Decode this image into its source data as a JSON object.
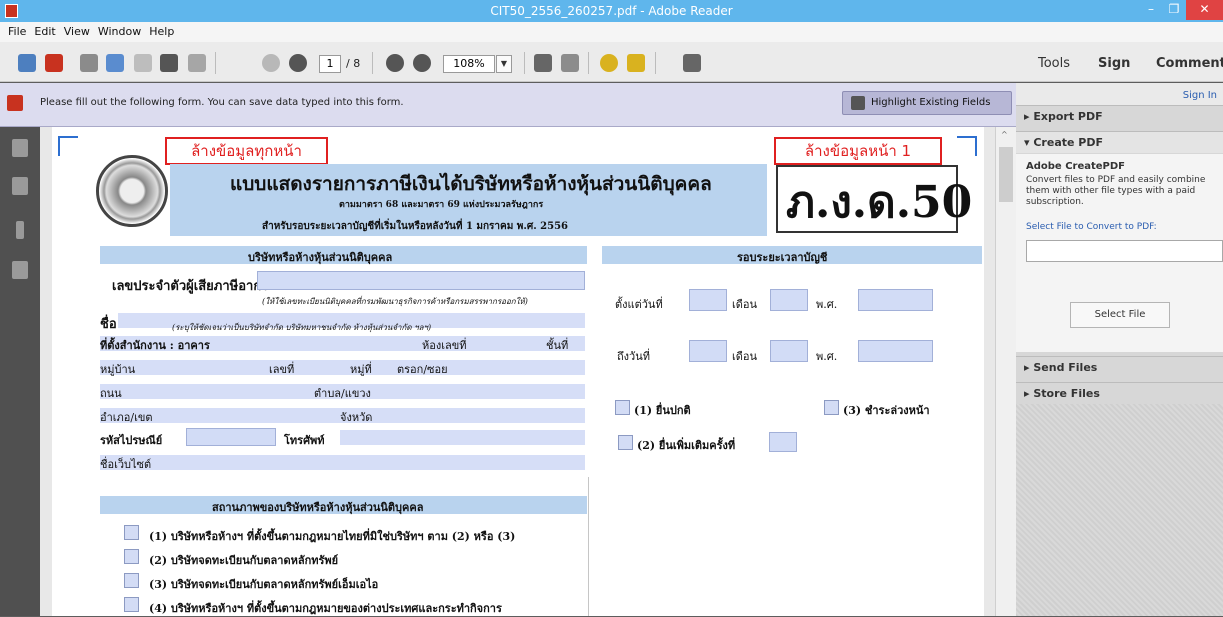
{
  "window": {
    "title": "CIT50_2556_260257.pdf - Adobe Reader",
    "min": "–",
    "restore": "❐",
    "close": "✕"
  },
  "menu": [
    "File",
    "Edit",
    "View",
    "Window",
    "Help"
  ],
  "toolbar": {
    "page_current": "1",
    "page_total": "/ 8",
    "zoom": "108%",
    "tabs": [
      "Tools",
      "Sign",
      "Comment"
    ]
  },
  "notice": {
    "text": "Please fill out the following form. You can save data typed into this form.",
    "button": "Highlight Existing Fields"
  },
  "panel": {
    "sign_in": "Sign In",
    "export": "Export PDF",
    "create": "Create PDF",
    "createpdf_title": "Adobe CreatePDF",
    "createpdf_desc": "Convert files to PDF and easily combine them with other file types with a paid subscription.",
    "select_label": "Select File to Convert to PDF:",
    "select_btn": "Select File",
    "send": "Send Files",
    "store": "Store Files"
  },
  "form": {
    "clear_all": "ล้างข้อมูลทุกหน้า",
    "clear_page": "ล้างข้อมูลหน้า 1",
    "title": "แบบแสดงรายการภาษีเงินได้บริษัทหรือห้างหุ้นส่วนนิติบุคคล",
    "law": "ตามมาตรา 68 และมาตรา 69 แห่งประมวลรัษฎากร",
    "period_line": "สำหรับรอบระยะเวลาบัญชีที่เริ่มในหรือหลังวันที่ 1 มกราคม พ.ศ. 2556",
    "form_code": "ภ.ง.ด.50",
    "sec_company": "บริษัทหรือห้างหุ้นส่วนนิติบุคคล",
    "sec_period": "รอบระยะเวลาบัญชี",
    "taxid": "เลขประจำตัวผู้เสียภาษีอากร",
    "taxid_note": "(ให้ใช้เลขทะเบียนนิติบุคคลที่กรมพัฒนาธุรกิจการค้าหรือกรมสรรพากรออกให้)",
    "name": "ชื่อ",
    "name_note": "(ระบุให้ชัดเจนว่าเป็นบริษัทจำกัด บริษัทมหาชนจำกัด ห้างหุ้นส่วนจำกัด ฯลฯ)",
    "office": "ที่ตั้งสำนักงาน : อาคาร",
    "room": "ห้องเลขที่",
    "floor": "ชั้นที่",
    "village": "หมู่บ้าน",
    "addr_no": "เลขที่",
    "moo": "หมู่ที่",
    "soi": "ตรอก/ซอย",
    "road": "ถนน",
    "subdistrict": "ตำบล/แขวง",
    "district": "อำเภอ/เขต",
    "province": "จังหวัด",
    "postcode": "รหัสไปรษณีย์",
    "phone": "โทรศัพท์",
    "website": "ชื่อเว็บไซต์",
    "from_day": "ตั้งแต่วันที่",
    "to_day": "ถึงวันที่",
    "month": "เดือน",
    "year": "พ.ศ.",
    "opt1": "(1) ยื่นปกติ",
    "opt2": "(2) ยื่นเพิ่มเติมครั้งที่",
    "opt3": "(3) ชำระล่วงหน้า",
    "sec_status": "สถานภาพของบริษัทหรือห้างหุ้นส่วนนิติบุคคล",
    "status": [
      "(1)  บริษัทหรือห้างฯ ที่ตั้งขึ้นตามกฎหมายไทยที่มิใช่บริษัทฯ ตาม (2) หรือ (3)",
      "(2)  บริษัทจดทะเบียนกับตลาดหลักทรัพย์",
      "(3)  บริษัทจดทะเบียนกับตลาดหลักทรัพย์เอ็มเอไอ",
      "(4)  บริษัทหรือห้างฯ ที่ตั้งขึ้นตามกฎหมายของต่างประเทศและกระทำกิจการ"
    ]
  }
}
